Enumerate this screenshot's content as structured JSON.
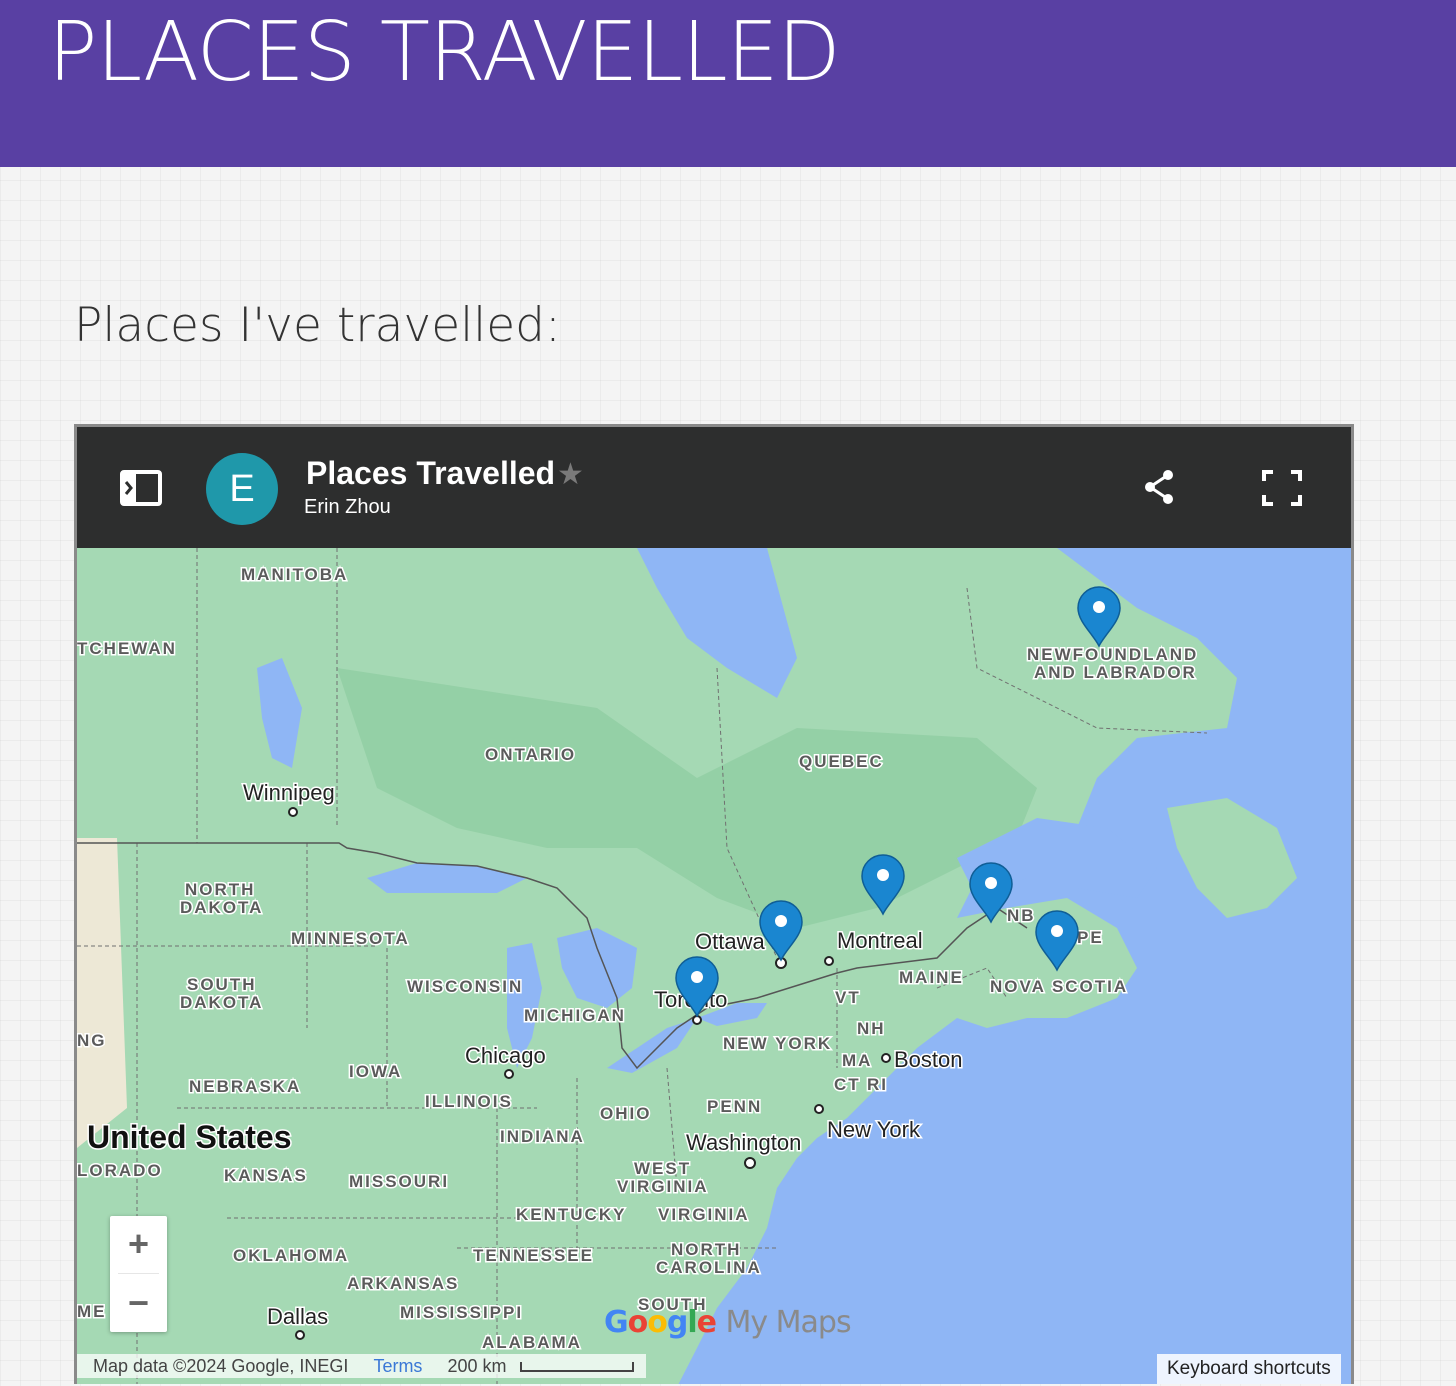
{
  "site": {
    "title": "PLACES TRAVELLED"
  },
  "section": {
    "heading": "Places I've travelled:"
  },
  "map": {
    "title": "Places Travelled",
    "author": "Erin Zhou",
    "avatar_letter": "E",
    "colors": {
      "toolbar": "#2d2e2e",
      "avatar": "#1f98aa",
      "water": "#8fb6f5",
      "land": "#9fd6b1",
      "marker": "#1a86d0"
    },
    "icons": [
      "sidebar-toggle-icon",
      "star-icon",
      "share-icon",
      "fullscreen-icon",
      "map-marker-icon"
    ],
    "labels": {
      "manitoba": "MANITOBA",
      "saskatchewan": "TCHEWAN",
      "ontario": "ONTARIO",
      "quebec": "QUEBEC",
      "nl_1": "NEWFOUNDLAND",
      "nl_2": "AND LABRADOR",
      "winnipeg": "Winnipeg",
      "north_dakota_1": "NORTH",
      "north_dakota_2": "DAKOTA",
      "minnesota": "MINNESOTA",
      "south_dakota_1": "SOUTH",
      "south_dakota_2": "DAKOTA",
      "wisconsin": "WISCONSIN",
      "michigan": "MICHIGAN",
      "ottawa": "Ottawa",
      "montreal": "Montreal",
      "toronto": "Toronto",
      "maine": "MAINE",
      "nb": "NB",
      "pe": "PE",
      "nova_scotia": "NOVA SCOTIA",
      "vt": "VT",
      "nh": "NH",
      "ma": "MA",
      "boston": "Boston",
      "ct": "CT",
      "ri": "RI",
      "new_york_state": "NEW YORK",
      "wyoming": "NG",
      "nebraska": "NEBRASKA",
      "iowa": "IOWA",
      "chicago": "Chicago",
      "illinois": "ILLINOIS",
      "ohio": "OHIO",
      "penn": "PENN",
      "new_york_city": "New York",
      "united_states": "United States",
      "colorado": "LORADO",
      "kansas": "KANSAS",
      "missouri": "MISSOURI",
      "indiana": "INDIANA",
      "washington": "Washington",
      "west_virginia_1": "WEST",
      "west_virginia_2": "VIRGINIA",
      "kentucky": "KENTUCKY",
      "virginia": "VIRGINIA",
      "oklahoma": "OKLAHOMA",
      "tennessee": "TENNESSEE",
      "north_carolina_1": "NORTH",
      "north_carolina_2": "CAROLINA",
      "arkansas": "ARKANSAS",
      "new_mexico": "ME",
      "dallas": "Dallas",
      "mississippi": "MISSISSIPPI",
      "south_carolina": "SOUTH",
      "alabama": "ALABAMA"
    },
    "markers": [
      "Newfoundland and Labrador",
      "Montreal",
      "Ottawa",
      "Toronto",
      "New Brunswick",
      "Nova Scotia"
    ],
    "zoom_in_label": "+",
    "zoom_out_label": "−",
    "attribution": "Map data ©2024 Google, INEGI",
    "terms_label": "Terms",
    "scale_label": "200 km",
    "keyboard_shortcuts": "Keyboard shortcuts",
    "logo": {
      "google": "Google",
      "mymaps": "My Maps"
    }
  }
}
